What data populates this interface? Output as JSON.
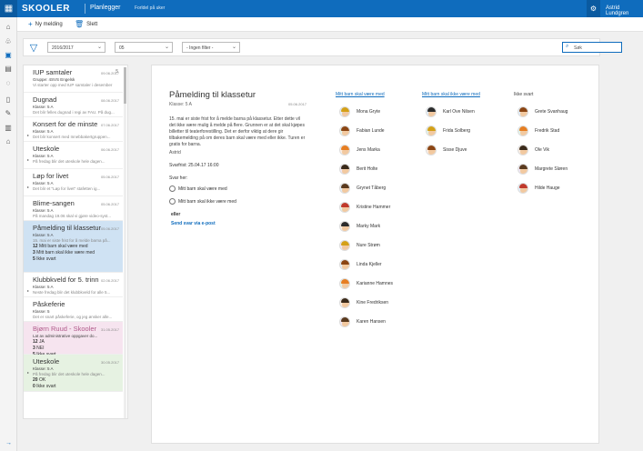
{
  "topbar": {
    "logo": "SKOOLER",
    "app": "Planlegger",
    "subtitle": "Forldel på uker",
    "user": "Astrid Lundgren"
  },
  "nav": {
    "icons": [
      "home-icon",
      "tree-icon",
      "messages-icon",
      "calendar-icon",
      "chat-icon",
      "book-icon",
      "ruler-icon",
      "chart-icon",
      "school-icon"
    ]
  },
  "commands": {
    "new": "Ny melding",
    "delete": "Slett"
  },
  "filters": {
    "year": "2016/2017",
    "number": "05",
    "filter": "- Ingen filter -",
    "search_placeholder": "Søk"
  },
  "list": [
    {
      "title": "IUP samtaler",
      "count": "5",
      "line2": "Gruppe: 4SVS Engelsk",
      "line3": "Vi starter opp med IUP samtaler i desember",
      "date": "09.06.2017",
      "style": ""
    },
    {
      "title": "Dugnad",
      "line2": "Klasse: 5 A",
      "line3": "Det blir felles dugnad i regi av FAU. På dug...",
      "date": "08.06.2017",
      "style": ""
    },
    {
      "title": "Konsert for de minste",
      "line2": "Klasse: 5 A",
      "line3": "Det blir konsert med Innebbakertgruppen...",
      "date": "07.06.2017",
      "style": "",
      "arrow": true
    },
    {
      "title": "Uteskole",
      "line2": "Klasse: 5 A",
      "line3": "På fredag blir det uteskole hele dagen...",
      "date": "06.06.2017",
      "style": "",
      "arrow": true
    },
    {
      "title": "Løp for livet",
      "line2": "Klasse: 5 A",
      "line3": "Det blir et \"Løp for livet\" stafetten ig...",
      "date": "05.06.2017",
      "style": "",
      "arrow": true
    },
    {
      "title": "Blime-sangen",
      "line2": "Klasse: 5 A",
      "line3": "På mandag 19.06 skal vi gjøre video-syst...",
      "date": "05.06.2017",
      "style": ""
    },
    {
      "title": "Påmelding til klassetur",
      "line2": "Klasse: 5 A",
      "line3": "15. mai er siste frist for å melde barna på...",
      "date": "05.06.2017",
      "style": "selected",
      "stats": [
        {
          "n": "12",
          "label": "Mitt barn skal være med"
        },
        {
          "n": "3",
          "label": "Mitt barn skal ikke være med"
        },
        {
          "n": "5",
          "label": "Ikke svart"
        }
      ]
    },
    {
      "title": "Klubbkveld for 5. trinn",
      "line2": "Klasse: 5 A",
      "line3": "Neste fredag blir det klubbkveld for alle 5...",
      "date": "02.06.2017",
      "style": "",
      "arrow": true
    },
    {
      "title": "Påskeferie",
      "line2": "Klasse: 5",
      "line3": "Det er snart påskeferie, og jeg ønsker alle...",
      "date": "",
      "style": ""
    },
    {
      "title": "Bjørn Ruud - Skooler",
      "line2": "Lat av administrative oppgaver do...",
      "line3": "",
      "date": "31.05.2017",
      "style": "pink",
      "stats": [
        {
          "n": "12",
          "label": "JA"
        },
        {
          "n": "3",
          "label": "NEI"
        },
        {
          "n": "5",
          "label": "Ikke svart"
        }
      ]
    },
    {
      "title": "Uteskole",
      "line2": "Klasse: 5 A",
      "line3": "På fredag blir det uteskole hele dagen...",
      "date": "30.05.2017",
      "style": "green",
      "arrow": true,
      "stats": [
        {
          "n": "20",
          "label": "OK"
        },
        {
          "n": "0",
          "label": "Ikke svart"
        }
      ]
    }
  ],
  "detail": {
    "title": "Påmelding til klassetur",
    "klasse": "Klasse: 5 A",
    "date": "05.06.2017",
    "body": "15. mai er siste frist for å melde barna på klassetur. Etter dette vil det ikke være mulig å melde på flere. Grunnen er at det skal kjøpes billetter til teaterforestilling. Det er derfor viktig at dere gir tilbakemelding på om deres barn skal være med eller ikke. Turen er gratis for barna.",
    "author": "Astrid",
    "deadline": "Svarfrist: 25.04.17 16:00",
    "reply_here": "Svar her:",
    "option_yes": "Mitt barn skal være med",
    "option_no": "Mitt barn skal ikke være med",
    "or": "eller",
    "email_link": "Send svar via e-post"
  },
  "columns": {
    "yes": {
      "header": "Mitt barn skal være med",
      "people": [
        "Mona Gryte",
        "Fabian Lunde",
        "Jens Marka",
        "Berit Holte",
        "Grynet Tåberg",
        "Kristine Hammer",
        "Marky Mark",
        "Nure Strøm",
        "Linda Kjeller",
        "Karianne Hamnes",
        "Kine Fredriksen",
        "Karen Hansen"
      ]
    },
    "no": {
      "header": "Mitt barn skal ikke være med",
      "people": [
        "Karl Ove Nilsen",
        "Frida Solberg",
        "Sisse Djuve"
      ]
    },
    "none": {
      "header": "Ikke svart",
      "people": [
        "Grete Svanhaug",
        "Fredrik Stad",
        "Ole Vik",
        "Margrete Sløren",
        "Hilde Hauge"
      ]
    }
  },
  "colors": {
    "brand": "#0f6cbd",
    "selected": "#cfe2f3",
    "pink": "#f6e4ef",
    "green": "#e6f2e2"
  }
}
